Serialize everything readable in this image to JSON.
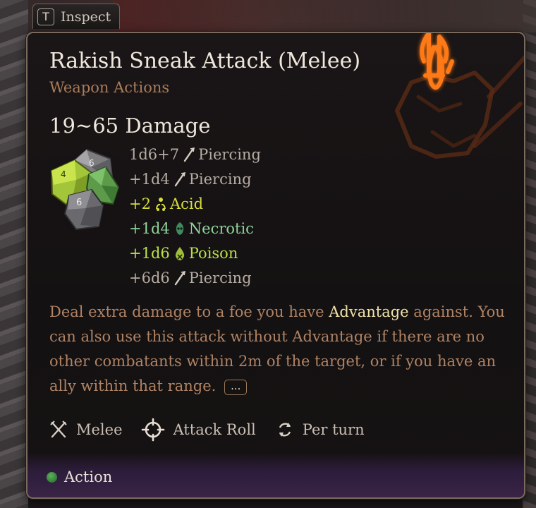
{
  "inspect": {
    "key": "T",
    "label": "Inspect"
  },
  "title": "Rakish Sneak Attack (Melee)",
  "subtitle": "Weapon Actions",
  "damage_summary": "19~65 Damage",
  "damage_rows": [
    {
      "amount": "1d6+7",
      "type": "Piercing",
      "color": "#b5aca3",
      "icon": "piercing-icon"
    },
    {
      "amount": "+1d4",
      "type": "Piercing",
      "color": "#b5aca3",
      "icon": "piercing-icon"
    },
    {
      "amount": "+2",
      "type": "Acid",
      "color": "#d6de3a",
      "icon": "acid-icon"
    },
    {
      "amount": "+1d4",
      "type": "Necrotic",
      "color": "#8fd49a",
      "icon": "necrotic-icon"
    },
    {
      "amount": "+1d6",
      "type": "Poison",
      "color": "#b9e04a",
      "icon": "poison-icon"
    },
    {
      "amount": "+6d6",
      "type": "Piercing",
      "color": "#b5aca3",
      "icon": "piercing-icon"
    }
  ],
  "description": {
    "part1": "Deal extra damage to a foe you have ",
    "highlight": "Advantage",
    "part2": " against. You can also use this attack without Advantage if there are no other combatants within 2m of the target, or if you have an ally within that range.",
    "more_label": "..."
  },
  "properties": [
    {
      "label": "Melee",
      "icon": "crossed-swords-icon"
    },
    {
      "label": "Attack Roll",
      "icon": "crosshair-icon"
    },
    {
      "label": "Per turn",
      "icon": "recharge-icon"
    }
  ],
  "cost": {
    "label": "Action",
    "color": "#3f9a45"
  },
  "colors": {
    "title": "#efe7dc",
    "subtitle": "#a97d5a",
    "description": "#b08364",
    "highlight": "#efe1a8",
    "emblem": "#ff7a18"
  }
}
